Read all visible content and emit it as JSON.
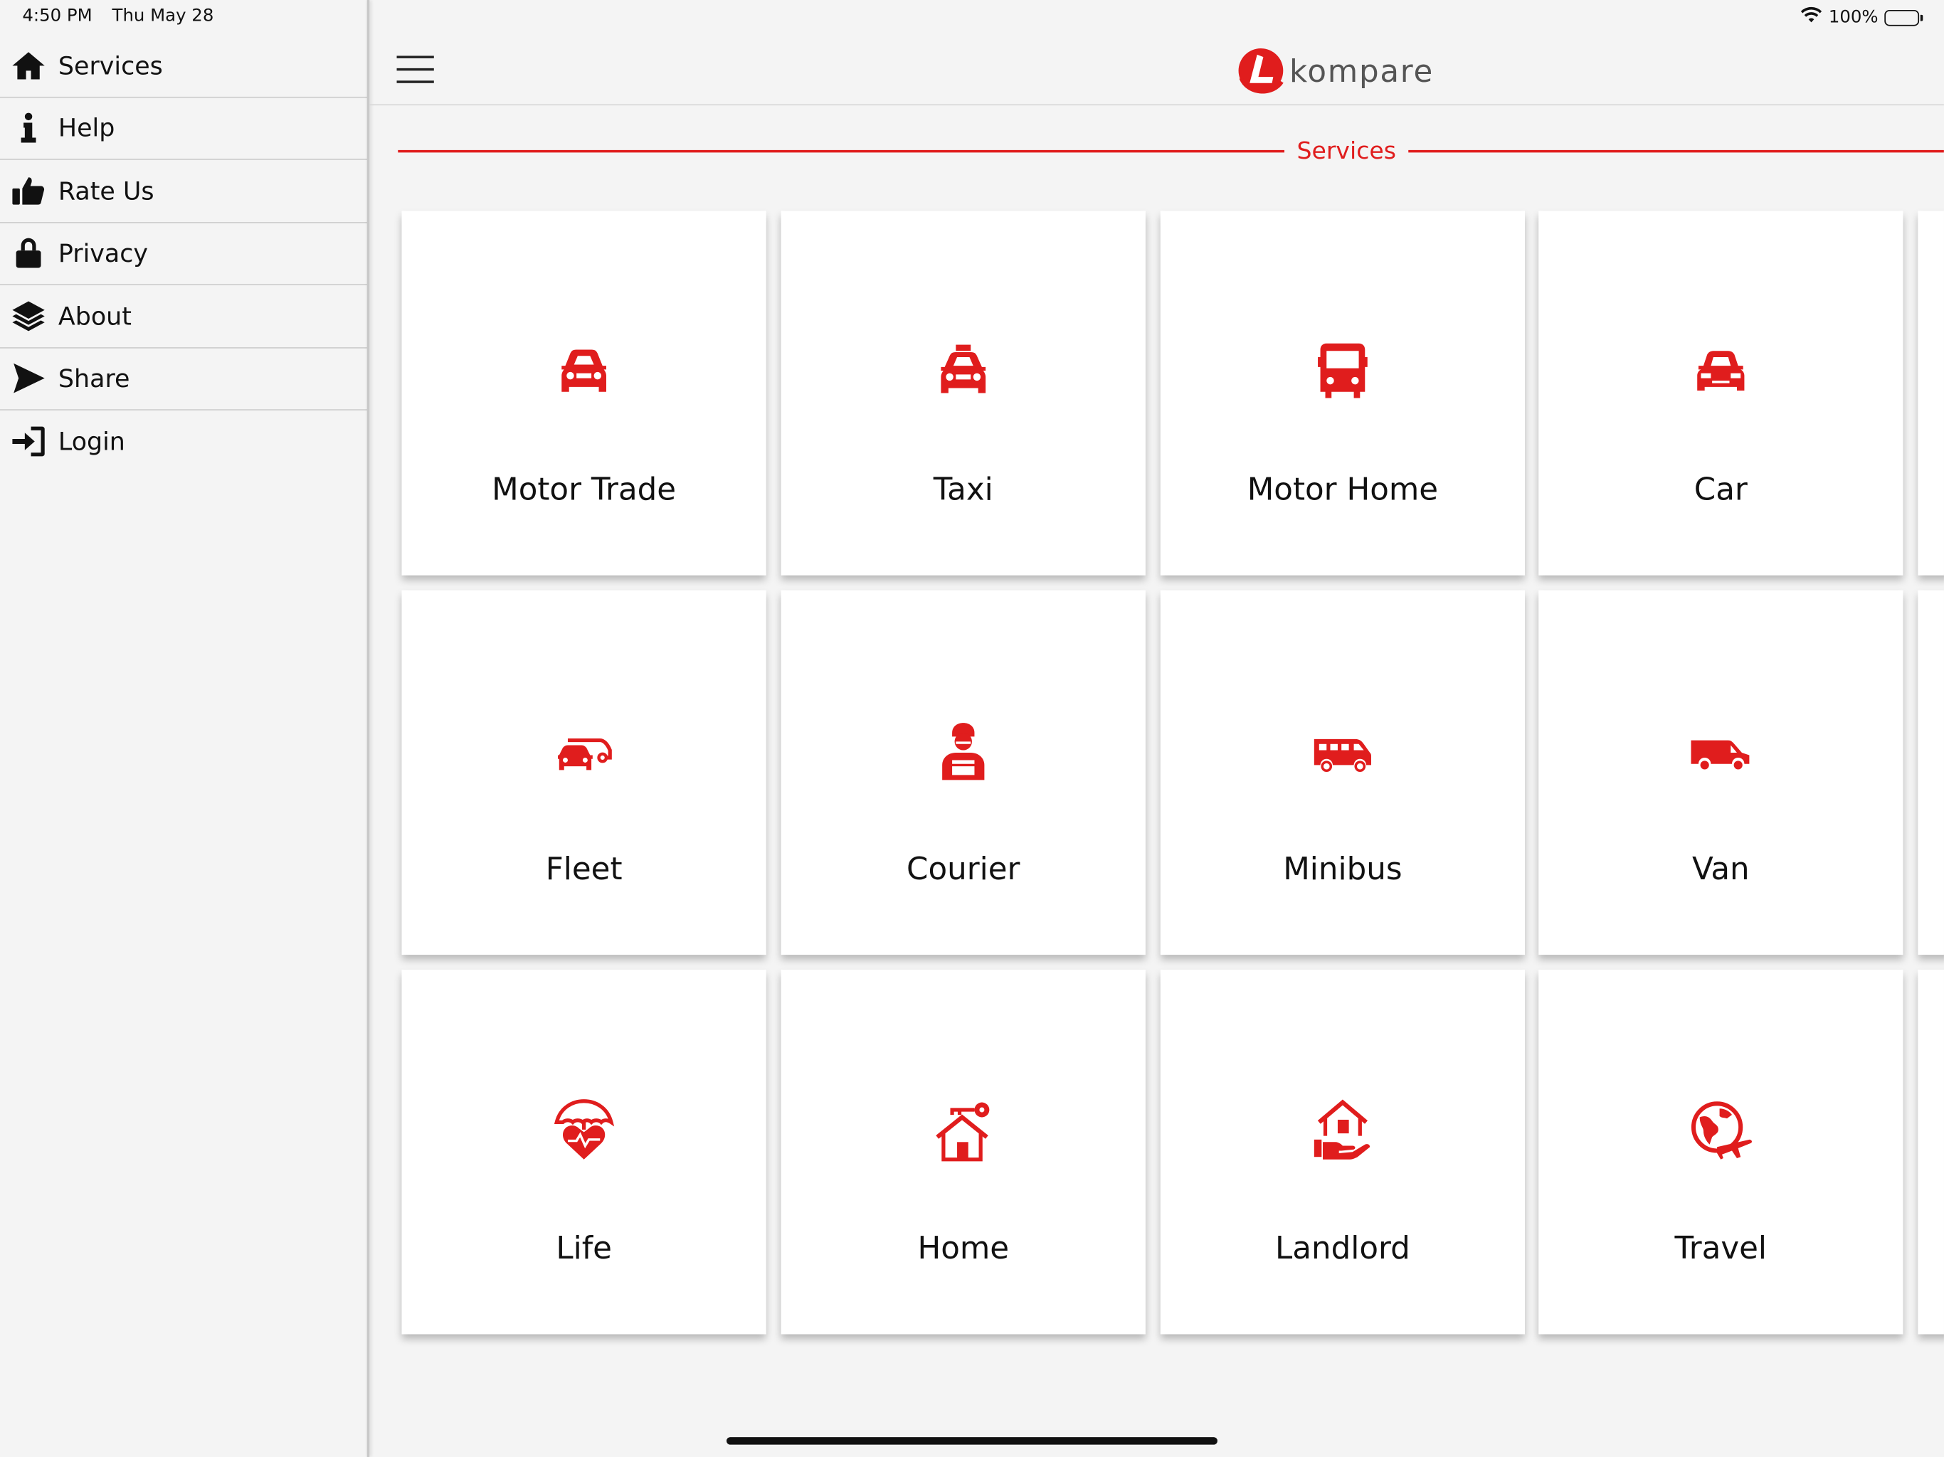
{
  "status_bar": {
    "time": "4:50 PM",
    "date": "Thu May 28",
    "battery": "100%",
    "battery_level": 1.0
  },
  "sidebar": {
    "items": [
      {
        "label": "Services",
        "icon": "home-icon"
      },
      {
        "label": "Help",
        "icon": "info-icon"
      },
      {
        "label": "Rate Us",
        "icon": "thumbs-up-icon"
      },
      {
        "label": "Privacy",
        "icon": "lock-icon"
      },
      {
        "label": "About",
        "icon": "layers-icon"
      },
      {
        "label": "Share",
        "icon": "send-icon"
      },
      {
        "label": "Login",
        "icon": "login-icon"
      }
    ]
  },
  "header": {
    "logo_text": "kompare"
  },
  "main": {
    "section_title": "Services",
    "services": [
      {
        "label": "Motor Trade",
        "icon": "car-front-icon"
      },
      {
        "label": "Taxi",
        "icon": "taxi-icon"
      },
      {
        "label": "Motor Home",
        "icon": "bus-icon"
      },
      {
        "label": "Car",
        "icon": "mini-car-icon"
      },
      {
        "label": "Fleet",
        "icon": "fleet-icon"
      },
      {
        "label": "Courier",
        "icon": "courier-icon"
      },
      {
        "label": "Minibus",
        "icon": "minibus-icon"
      },
      {
        "label": "Van",
        "icon": "van-icon"
      },
      {
        "label": "Life",
        "icon": "umbrella-heart-icon"
      },
      {
        "label": "Home",
        "icon": "house-key-icon"
      },
      {
        "label": "Landlord",
        "icon": "house-hand-icon"
      },
      {
        "label": "Travel",
        "icon": "globe-plane-icon"
      }
    ]
  },
  "colors": {
    "accent": "#e01d1d",
    "background": "#f4f4f4",
    "tile": "#ffffff"
  }
}
